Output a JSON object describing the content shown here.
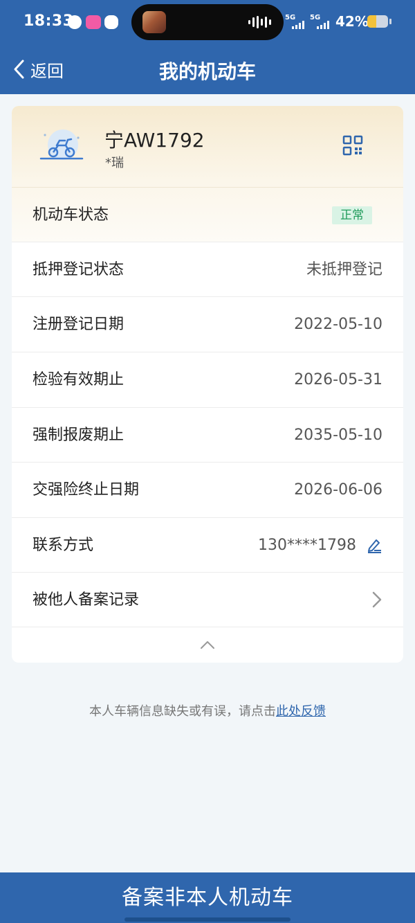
{
  "status_bar": {
    "time": "18:33",
    "network_1": "5G",
    "network_2": "5G",
    "battery": "42%",
    "battery_level": 0.42,
    "app_icons": [
      "app-notification-icon",
      "music-app-icon",
      "wechat-icon"
    ]
  },
  "nav": {
    "back_label": "返回",
    "title": "我的机动车"
  },
  "vehicle": {
    "plate": "宁AW1792",
    "owner": "*瑞",
    "illustration": "motorcycle-icon"
  },
  "details": {
    "status_label": "机动车状态",
    "status_value": "正常",
    "mortgage_label": "抵押登记状态",
    "mortgage_value": "未抵押登记",
    "register_label": "注册登记日期",
    "register_value": "2022-05-10",
    "inspection_label": "检验有效期止",
    "inspection_value": "2026-05-31",
    "scrap_label": "强制报废期止",
    "scrap_value": "2035-05-10",
    "insurance_label": "交强险终止日期",
    "insurance_value": "2026-06-06",
    "contact_label": "联系方式",
    "contact_value": "130****1798",
    "records_label": "被他人备案记录"
  },
  "feedback": {
    "text": "本人车辆信息缺失或有误，请点击",
    "link": "此处反馈"
  },
  "bottom_button": "备案非本人机动车",
  "colors": {
    "primary": "#2f66ad",
    "badge_bg": "#d9f3e5",
    "badge_text": "#1f9b5a",
    "card_top": "#f6ead0"
  }
}
